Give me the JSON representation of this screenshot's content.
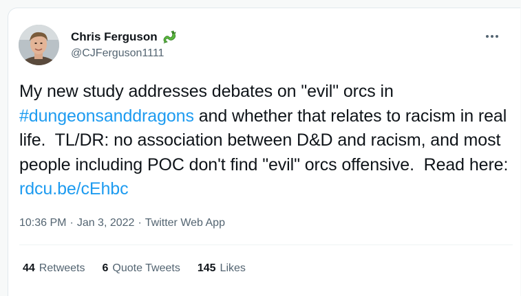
{
  "author": {
    "display_name": "Chris Ferguson",
    "handle": "@CJFerguson1111",
    "name_emoji": "dragon-emoji",
    "avatar": "avatar-photo"
  },
  "menu": {
    "more_icon": "more-horizontal-icon"
  },
  "tweet": {
    "text_part1": "My new study addresses debates on \"evil\" orcs in ",
    "hashtag": "#dungeonsanddragons",
    "text_part2": " and whether that relates to racism in real life.  TL/DR: no association between D&D and racism, and most people including POC don't find \"evil\" orcs offensive.  Read here: ",
    "link": "rdcu.be/cEhbc"
  },
  "meta": {
    "time": "10:36 PM",
    "separator": "·",
    "date": "Jan 3, 2022",
    "source": "Twitter Web App"
  },
  "stats": {
    "retweets_count": "44",
    "retweets_label": "Retweets",
    "quote_count": "6",
    "quote_label": "Quote Tweets",
    "likes_count": "145",
    "likes_label": "Likes"
  },
  "colors": {
    "link": "#1d9bf0",
    "text": "#0f1419",
    "secondary": "#536471"
  }
}
